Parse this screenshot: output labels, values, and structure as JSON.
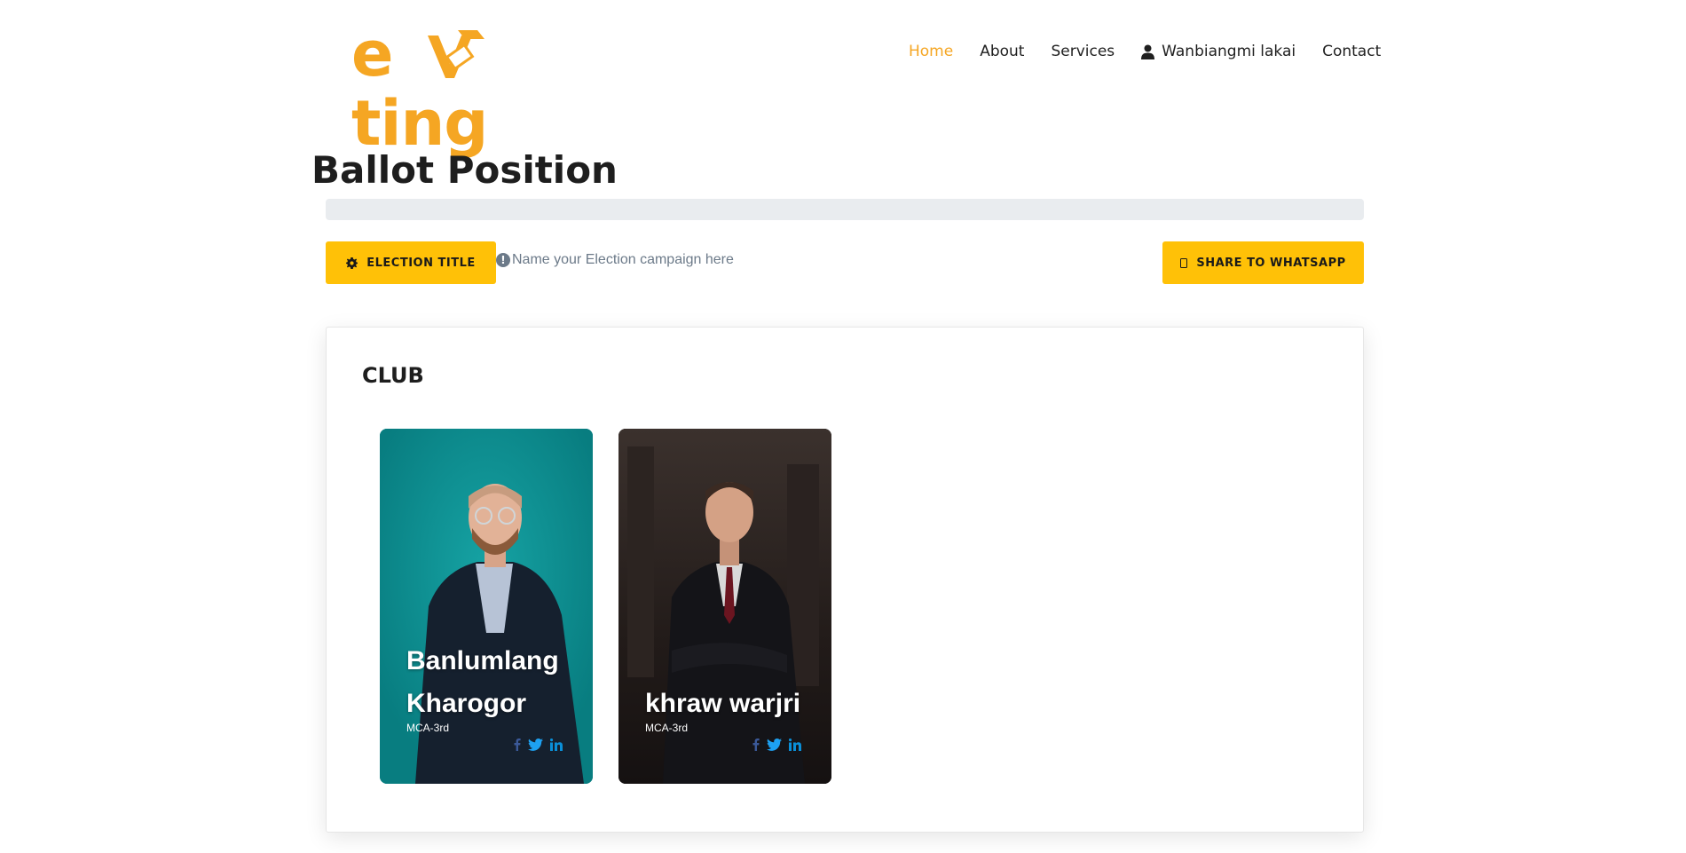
{
  "brand": {
    "logo_text": "eVting",
    "accent_color": "#f5a623"
  },
  "nav": {
    "items": [
      {
        "label": "Home",
        "active": true
      },
      {
        "label": "About",
        "active": false
      },
      {
        "label": "Services",
        "active": false
      },
      {
        "label": "Wanbiangmi lakai",
        "active": false,
        "icon": "user-icon"
      },
      {
        "label": "Contact",
        "active": false
      }
    ]
  },
  "page": {
    "title": "Ballot Position"
  },
  "progress": {
    "value": 0
  },
  "actions": {
    "election_title_label": "ELECTION TITLE",
    "election_title_icon": "gear-icon",
    "hint_text": "Name your Election campaign here",
    "hint_icon": "info-icon",
    "share_label": "SHARE TO WHATSAPP",
    "share_icon": "whatsapp-icon",
    "button_color": "#ffc107"
  },
  "position": {
    "name": "CLUB",
    "candidates": [
      {
        "name_line1": "Banlumlang",
        "name_line2": "Kharogor",
        "class": "MCA-3rd",
        "background": "#0b8f91"
      },
      {
        "name_line1": "khraw warjri",
        "name_line2": "",
        "class": "MCA-3rd",
        "background": "#231c1b"
      }
    ]
  }
}
